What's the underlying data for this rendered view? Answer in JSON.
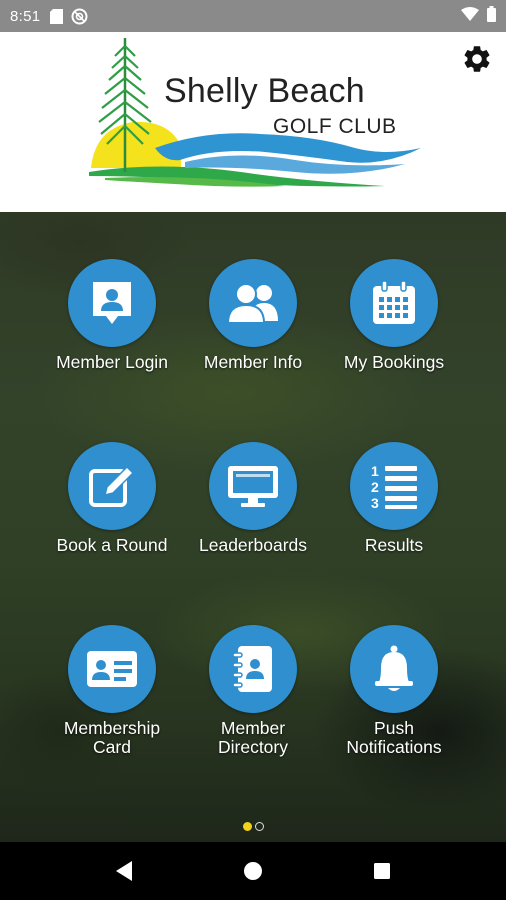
{
  "status_bar": {
    "time": "8:51",
    "icons": [
      "sd-card-icon",
      "do-not-disturb-icon",
      "wifi-icon",
      "battery-icon"
    ]
  },
  "header": {
    "logo_line1": "Shelly Beach",
    "logo_line2": "GOLF CLUB",
    "settings_icon": "gear-icon"
  },
  "menu": [
    {
      "label": "Member Login",
      "icon": "member-login-icon"
    },
    {
      "label": "Member Info",
      "icon": "members-icon"
    },
    {
      "label": "My Bookings",
      "icon": "calendar-icon"
    },
    {
      "label": "Book a Round",
      "icon": "edit-icon"
    },
    {
      "label": "Leaderboards",
      "icon": "monitor-icon"
    },
    {
      "label": "Results",
      "icon": "numbered-list-icon"
    },
    {
      "label": "Membership\nCard",
      "icon": "id-card-icon"
    },
    {
      "label": "Member\nDirectory",
      "icon": "contacts-book-icon"
    },
    {
      "label": "Push\nNotifications",
      "icon": "bell-icon"
    }
  ],
  "pager": {
    "pages": 2,
    "current": 1
  },
  "colors": {
    "accent_blue": "#2f8fcf",
    "status_bar": "#8a8a8a",
    "active_dot": "#f2d21a"
  },
  "nav_bar": {
    "icons": [
      "back-icon",
      "home-icon",
      "recents-icon"
    ]
  }
}
